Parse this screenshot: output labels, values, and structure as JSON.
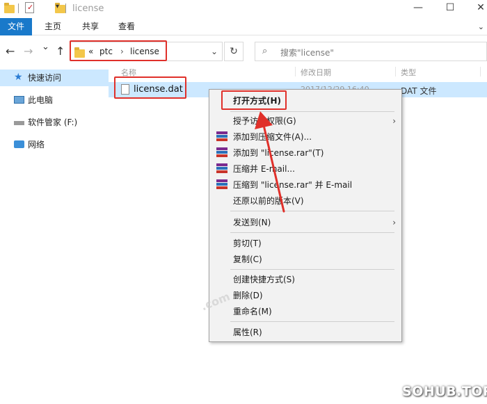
{
  "window": {
    "title": "license",
    "controls": {
      "minimize": "—",
      "maximize": "☐",
      "close": "✕"
    }
  },
  "ribbon": {
    "tabs": [
      "文件",
      "主页",
      "共享",
      "查看"
    ],
    "expand_icon": "chevron-down-icon"
  },
  "navigation": {
    "back": "←",
    "forward": "→",
    "recent": "⌄",
    "up": "↑"
  },
  "address": {
    "overflow": "«",
    "crumbs": [
      "ptc",
      "license"
    ],
    "separator": "›",
    "dropdown": "⌄",
    "refresh": "↻"
  },
  "search": {
    "icon": "⌕",
    "placeholder": "搜索\"license\""
  },
  "sidebar": {
    "items": [
      {
        "label": "快速访问",
        "icon": "star-icon",
        "selected": true
      },
      {
        "label": "此电脑",
        "icon": "monitor-icon",
        "selected": false
      },
      {
        "label": "软件管家 (F:)",
        "icon": "drive-icon",
        "selected": false
      },
      {
        "label": "网络",
        "icon": "network-icon",
        "selected": false
      }
    ]
  },
  "file_list": {
    "columns": [
      "名称",
      "修改日期",
      "类型"
    ],
    "files": [
      {
        "name": "license.dat",
        "modified": "2017/12/29 16:40",
        "type": "DAT 文件"
      }
    ]
  },
  "context_menu": {
    "items": [
      {
        "label": "打开方式(H)",
        "bold": true
      },
      {
        "label": "授予访问权限(G)",
        "submenu": true
      },
      {
        "label": "添加到压缩文件(A)...",
        "icon": "winrar-icon"
      },
      {
        "label": "添加到 \"license.rar\"(T)",
        "icon": "winrar-icon"
      },
      {
        "label": "压缩并 E-mail...",
        "icon": "winrar-icon"
      },
      {
        "label": "压缩到 \"license.rar\" 并 E-mail",
        "icon": "winrar-icon"
      },
      {
        "label": "还原以前的版本(V)"
      },
      {
        "label": "发送到(N)",
        "submenu": true
      },
      {
        "label": "剪切(T)"
      },
      {
        "label": "复制(C)"
      },
      {
        "label": "创建快捷方式(S)"
      },
      {
        "label": "删除(D)"
      },
      {
        "label": "重命名(M)"
      },
      {
        "label": "属性(R)"
      }
    ],
    "submenu_arrow": "›"
  },
  "watermark": {
    "text": ".com",
    "brand": "SOHUB.TOP"
  },
  "colors": {
    "accent": "#1979ca",
    "selection": "#cce8ff",
    "highlight": "#e0302a"
  }
}
